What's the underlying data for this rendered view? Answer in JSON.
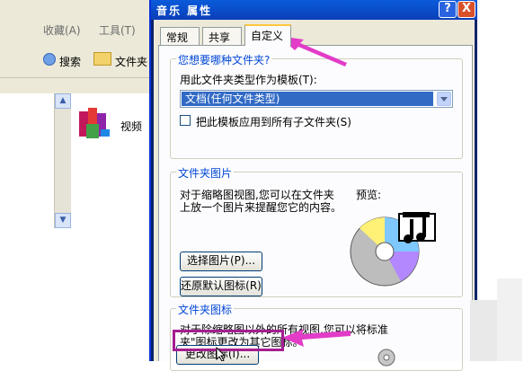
{
  "explorer": {
    "menu_favorites": "收藏(A)",
    "menu_tools": "工具(T)",
    "search_label": "搜索",
    "folders_label": "文件夹",
    "item_label": "视频"
  },
  "dialog": {
    "title": "音乐 属性",
    "help_glyph": "?",
    "close_glyph": "X",
    "tabs": [
      "常规",
      "共享",
      "自定义"
    ],
    "template_group": {
      "title": "您想要哪种文件夹?",
      "template_label": "用此文件夹类型作为模板(T):",
      "template_value": "文档(任何文件类型)",
      "apply_label": "把此模板应用到所有子文件夹(S)"
    },
    "pictures_group": {
      "title": "文件夹图片",
      "desc_line1": "对于缩略图视图,您可以在文件夹",
      "desc_line2": "上放一个图片来提醒您它的内容。",
      "preview_label": "预览:",
      "choose_button": "选择图片(P)...",
      "restore_button": "还原默认图标(R)"
    },
    "icons_group": {
      "title": "文件夹图标",
      "desc_line1": "对于除缩略图以外的所有视图,您可以将标准",
      "desc_line2": "夹\"图标更改为其它图标。",
      "change_button": "更改图标(I)..."
    }
  },
  "colors": {
    "annotation": "#e23cc8",
    "title_bar": "#0a5bdb",
    "group_title": "#0046d5",
    "highlight_box": "#a51e90"
  }
}
